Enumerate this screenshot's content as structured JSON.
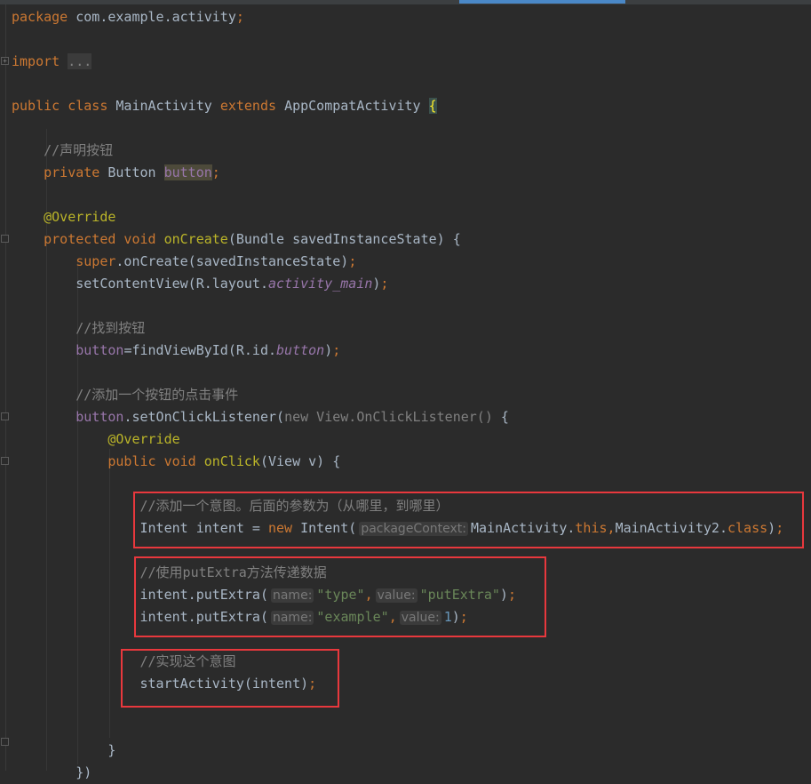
{
  "editor": {
    "theme_colors": {
      "background": "#2b2b2b",
      "keyword": "#cc7832",
      "text": "#a9b7c6",
      "comment": "#808080",
      "string": "#6a8759",
      "number": "#6897bb",
      "annotation": "#bbb529",
      "field": "#9876aa",
      "highlight_box": "#e8383d"
    },
    "lines": [
      [
        {
          "t": "package ",
          "c": "kw"
        },
        {
          "t": "com.example.activity",
          "c": "tx"
        },
        {
          "t": ";",
          "c": "kw"
        }
      ],
      [],
      [
        {
          "t": "import ",
          "c": "kw"
        },
        {
          "t": "...",
          "c": "fold"
        }
      ],
      [],
      [
        {
          "t": "public class ",
          "c": "kw"
        },
        {
          "t": "MainActivity ",
          "c": "tx"
        },
        {
          "t": "extends ",
          "c": "kw"
        },
        {
          "t": "AppCompatActivity ",
          "c": "tx"
        },
        {
          "t": "{",
          "c": "br"
        }
      ],
      [],
      [
        {
          "t": "    //声明按钮",
          "c": "cm"
        }
      ],
      [
        {
          "t": "    private ",
          "c": "kw"
        },
        {
          "t": "Button ",
          "c": "tx"
        },
        {
          "t": "button",
          "c": "fd hl"
        },
        {
          "t": ";",
          "c": "kw"
        }
      ],
      [],
      [
        {
          "t": "    @Override",
          "c": "an"
        }
      ],
      [
        {
          "t": "    protected void ",
          "c": "kw"
        },
        {
          "t": "onCreate",
          "c": "an"
        },
        {
          "t": "(Bundle savedInstanceState) {",
          "c": "tx"
        }
      ],
      [
        {
          "t": "        super",
          "c": "kw"
        },
        {
          "t": ".onCreate(savedInstanceState)",
          "c": "tx"
        },
        {
          "t": ";",
          "c": "kw"
        }
      ],
      [
        {
          "t": "        setContentView(R.layout.",
          "c": "tx"
        },
        {
          "t": "activity_main",
          "c": "it"
        },
        {
          "t": ")",
          "c": "tx"
        },
        {
          "t": ";",
          "c": "kw"
        }
      ],
      [],
      [
        {
          "t": "        //找到按钮",
          "c": "cm"
        }
      ],
      [
        {
          "t": "        button",
          "c": "fd"
        },
        {
          "t": "=findViewById(R.id.",
          "c": "tx"
        },
        {
          "t": "button",
          "c": "it"
        },
        {
          "t": ")",
          "c": "tx"
        },
        {
          "t": ";",
          "c": "kw"
        }
      ],
      [],
      [
        {
          "t": "        //添加一个按钮的点击事件",
          "c": "cm"
        }
      ],
      [
        {
          "t": "        button",
          "c": "fd"
        },
        {
          "t": ".setOnClickListener(",
          "c": "tx"
        },
        {
          "t": "new View.OnClickListener() ",
          "c": "cm"
        },
        {
          "t": "{",
          "c": "tx"
        }
      ],
      [
        {
          "t": "            @Override",
          "c": "an"
        }
      ],
      [
        {
          "t": "            public void ",
          "c": "kw"
        },
        {
          "t": "onClick",
          "c": "an"
        },
        {
          "t": "(View v) {",
          "c": "tx"
        }
      ],
      [],
      [
        {
          "t": "                //添加一个意图。后面的参数为（从哪里，到哪里）",
          "c": "cm"
        }
      ],
      [
        {
          "t": "                Intent intent = ",
          "c": "tx"
        },
        {
          "t": "new ",
          "c": "kw"
        },
        {
          "t": "Intent(",
          "c": "tx"
        },
        {
          "t": "packageContext:",
          "c": "hint"
        },
        {
          "t": "MainActivity.",
          "c": "tx"
        },
        {
          "t": "this,",
          "c": "kw"
        },
        {
          "t": "MainActivity2.",
          "c": "tx"
        },
        {
          "t": "class",
          "c": "kw"
        },
        {
          "t": ")",
          "c": "tx"
        },
        {
          "t": ";",
          "c": "kw"
        }
      ],
      [],
      [
        {
          "t": "                //使用putExtra方法传递数据",
          "c": "cm"
        }
      ],
      [
        {
          "t": "                intent.putExtra(",
          "c": "tx"
        },
        {
          "t": "name:",
          "c": "hint"
        },
        {
          "t": "\"type\"",
          "c": "st"
        },
        {
          "t": ",",
          "c": "kw"
        },
        {
          "t": "value:",
          "c": "hint"
        },
        {
          "t": "\"putExtra\"",
          "c": "st"
        },
        {
          "t": ")",
          "c": "tx"
        },
        {
          "t": ";",
          "c": "kw"
        }
      ],
      [
        {
          "t": "                intent.putExtra(",
          "c": "tx"
        },
        {
          "t": "name:",
          "c": "hint"
        },
        {
          "t": "\"example\"",
          "c": "st"
        },
        {
          "t": ",",
          "c": "kw"
        },
        {
          "t": "value:",
          "c": "hint"
        },
        {
          "t": "1",
          "c": "nu"
        },
        {
          "t": ")",
          "c": "tx"
        },
        {
          "t": ";",
          "c": "kw"
        }
      ],
      [],
      [
        {
          "t": "                //实现这个意图",
          "c": "cm"
        }
      ],
      [
        {
          "t": "                startActivity(intent)",
          "c": "tx"
        },
        {
          "t": ";",
          "c": "kw"
        }
      ],
      [],
      [],
      [
        {
          "t": "            }",
          "c": "tx"
        }
      ],
      [
        {
          "t": "        })",
          "c": "tx"
        }
      ]
    ]
  }
}
